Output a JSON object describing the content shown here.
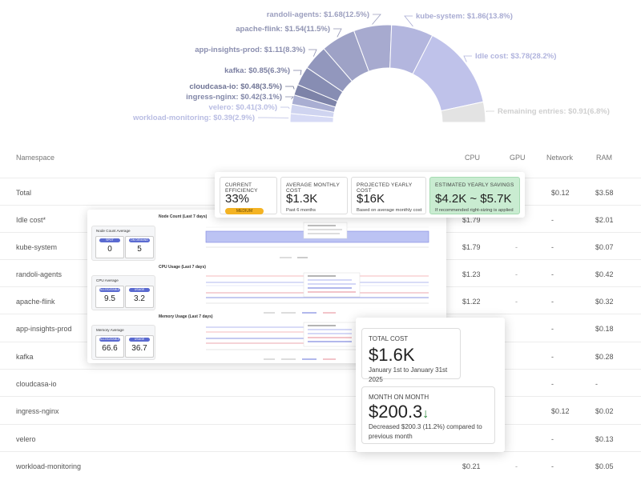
{
  "chart_data": {
    "type": "pie",
    "variant": "half-donut",
    "slices": [
      {
        "name": "workload-monitoring",
        "value": 0.39,
        "percent": 2.9,
        "label": "workload-monitoring: $0.39(2.9%)",
        "color": "#d6daf5"
      },
      {
        "name": "velero",
        "value": 0.41,
        "percent": 3.0,
        "label": "velero: $0.41(3.0%)",
        "color": "#cfd4f0"
      },
      {
        "name": "ingress-nginx",
        "value": 0.42,
        "percent": 3.1,
        "label": "ingress-nginx: $0.42(3.1%)",
        "color": "#a9aed2"
      },
      {
        "name": "cloudcasa-io",
        "value": 0.48,
        "percent": 3.5,
        "label": "cloudcasa-io: $0.48(3.5%)",
        "color": "#7d83a8"
      },
      {
        "name": "kafka",
        "value": 0.85,
        "percent": 6.3,
        "label": "kafka: $0.85(6.3%)",
        "color": "#878db3"
      },
      {
        "name": "app-insights-prod",
        "value": 1.11,
        "percent": 8.3,
        "label": "app-insights-prod: $1.11(8.3%)",
        "color": "#9297bd"
      },
      {
        "name": "apache-flink",
        "value": 1.54,
        "percent": 11.5,
        "label": "apache-flink: $1.54(11.5%)",
        "color": "#9ea2c6"
      },
      {
        "name": "randoli-agents",
        "value": 1.68,
        "percent": 12.5,
        "label": "randoli-agents: $1.68(12.5%)",
        "color": "#a7aacf"
      },
      {
        "name": "kube-system",
        "value": 1.86,
        "percent": 13.8,
        "label": "kube-system: $1.86(13.8%)",
        "color": "#b3b6de"
      },
      {
        "name": "Idle cost",
        "value": 3.78,
        "percent": 28.2,
        "label": "Idle cost: $3.78(28.2%)",
        "color": "#bfc2ea"
      },
      {
        "name": "Remaining entries",
        "value": 0.91,
        "percent": 6.8,
        "label": "Remaining entries: $0.91(6.8%)",
        "color": "#e3e3e3"
      }
    ]
  },
  "table": {
    "headers": {
      "namespace": "Namespace",
      "cpu": "CPU",
      "gpu": "GPU",
      "network": "Network",
      "ram": "RAM"
    },
    "rows": [
      {
        "ns": "Total",
        "cpu": "",
        "gpu": "",
        "net": "$0.12",
        "ram": "$3.58"
      },
      {
        "ns": "Idle cost*",
        "cpu": "$1.79",
        "gpu": "",
        "net": "-",
        "ram": "$2.01"
      },
      {
        "ns": "kube-system",
        "cpu": "$1.79",
        "gpu": "-",
        "net": "-",
        "ram": "$0.07"
      },
      {
        "ns": "randoli-agents",
        "cpu": "$1.23",
        "gpu": "-",
        "net": "-",
        "ram": "$0.42"
      },
      {
        "ns": "apache-flink",
        "cpu": "$1.22",
        "gpu": "-",
        "net": "-",
        "ram": "$0.32"
      },
      {
        "ns": "app-insights-prod",
        "cpu": "",
        "gpu": "",
        "net": "-",
        "ram": "$0.18"
      },
      {
        "ns": "kafka",
        "cpu": "",
        "gpu": "",
        "net": "-",
        "ram": "$0.28"
      },
      {
        "ns": "cloudcasa-io",
        "cpu": "",
        "gpu": "",
        "net": "-",
        "ram": "-"
      },
      {
        "ns": "ingress-nginx",
        "cpu": "",
        "gpu": "",
        "net": "$0.12",
        "ram": "$0.02"
      },
      {
        "ns": "velero",
        "cpu": "",
        "gpu": "",
        "net": "-",
        "ram": "$0.13"
      },
      {
        "ns": "workload-monitoring",
        "cpu": "$0.21",
        "gpu": "-",
        "net": "-",
        "ram": "$0.05"
      }
    ]
  },
  "efficiency": {
    "current": {
      "title": "CURRENT EFFICIENCY",
      "value": "33%",
      "badge": "MEDIUM"
    },
    "monthly": {
      "title": "AVERAGE MONTHLY COST",
      "value": "$1.3K",
      "sub": "Past 6 months"
    },
    "yearly": {
      "title": "PROJECTED YEARLY COST",
      "value": "$16K",
      "sub": "Based on average monthly cost"
    },
    "savings": {
      "title": "ESTIMATED YEARLY SAVINGS",
      "value": "$4.2K ~ $5.7K",
      "sub": "If recommended right-sizing is applied"
    }
  },
  "usage": {
    "node": {
      "avg_title": "Node Count Average",
      "a_label": "SPOT",
      "a_value": "0",
      "b_label": "ON DEMAND",
      "b_value": "5",
      "chart_title": "Node Count (Last 7 days)"
    },
    "cpu": {
      "avg_title": "CPU Average",
      "a_label": "ALLOCATABLE",
      "a_value": "9.5",
      "b_label": "USAGE",
      "b_value": "3.2",
      "chart_title": "CPU Usage (Last 7 days)"
    },
    "mem": {
      "avg_title": "Memory Average",
      "a_label": "ALLOCATABLE",
      "a_value": "66.6",
      "b_label": "USAGE",
      "b_value": "36.7",
      "chart_title": "Memory Usage (Last 7 days)"
    }
  },
  "cost": {
    "total_title": "TOTAL COST",
    "total_value": "$1.6K",
    "total_sub": "January 1st to January 31st 2025",
    "mom_title": "MONTH ON MONTH",
    "mom_value": "$200.3",
    "mom_arrow": "↓",
    "mom_sub": "Decreased $200.3 (11.2%) compared to previous month"
  }
}
